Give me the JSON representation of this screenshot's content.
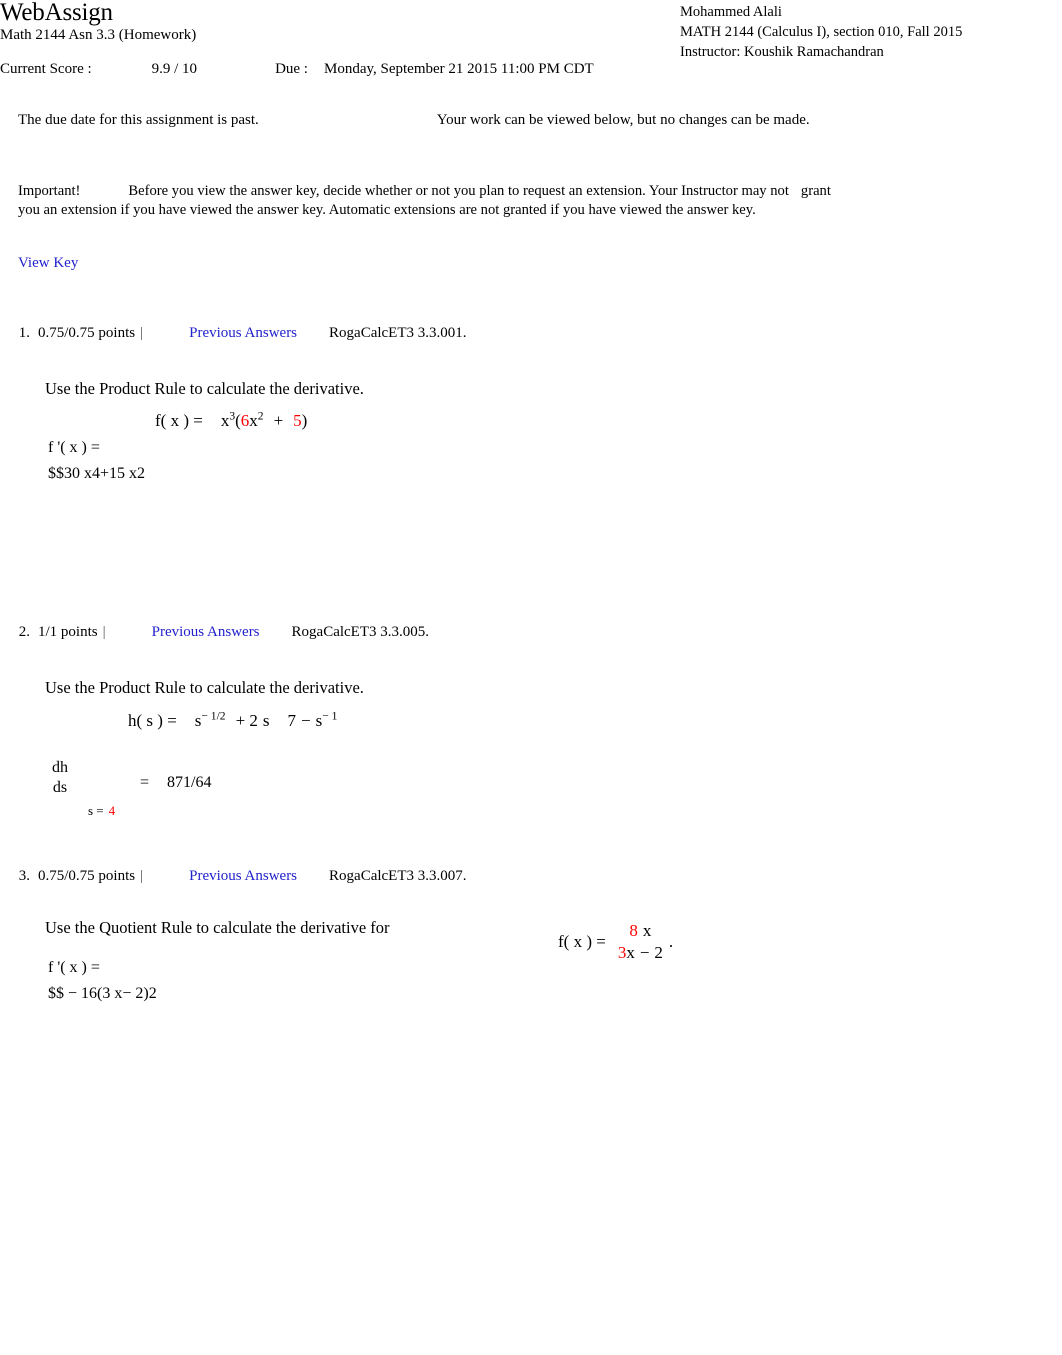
{
  "header": {
    "brand": "WebAssign",
    "assignment_title": "Math 2144 Asn 3.3 (Homework)",
    "student_name": "Mohammed Alali",
    "course_line": "MATH 2144 (Calculus I), section 010, Fall 2015",
    "instructor_line": "Instructor: Koushik Ramachandran",
    "score_label": "Current Score :",
    "score_value": "9.9 / 10",
    "due_label": "Due :",
    "due_value": "Monday, September 21 2015 11:00 PM CDT"
  },
  "notices": {
    "past_due_left": "The due date for this assignment is past.",
    "past_due_right": "Your work can be viewed below, but no changes can be made.",
    "important_word": "Important!",
    "important_text_a": "Before you view the answer key, decide whether or not you plan to request an extension. Your Instructor may",
    "important_text_b": "not",
    "important_text_c": "grant you an extension if you have viewed the answer key. Automatic extensions are not granted if you have viewed the",
    "important_text_d": "answer key.",
    "view_key_label": "View Key"
  },
  "colors": {
    "link_blue": "#2222CC",
    "highlight_red": "#FF0000",
    "text_black": "#000000"
  },
  "questions": [
    {
      "number": "1.",
      "points": "0.75/0.75 points",
      "separator": "|",
      "previous_answers_label": "Previous Answers",
      "problem_code": "RogaCalcET3 3.3.001.",
      "prompt": "Use the Product Rule to calculate the derivative.",
      "function_label": "f( x ) =",
      "function_base": "x",
      "function_base_exp": "3",
      "function_paren_open": "(",
      "function_coef": "6",
      "function_var": "x",
      "function_var_exp": "2",
      "function_plus": "+",
      "function_const": "5",
      "function_paren_close": ")",
      "answer_label": "f '( x ) =",
      "answer_value": "$$30  x4+15  x2"
    },
    {
      "number": "2.",
      "points": "1/1 points",
      "separator": "|",
      "previous_answers_label": "Previous Answers",
      "problem_code": "RogaCalcET3 3.3.005.",
      "prompt": "Use the Product Rule to calculate the derivative.",
      "function_label": "h( s ) =",
      "term1_base": "s",
      "term1_exp": "− 1/2",
      "term2_plus": "+ 2",
      "term2_var": "s",
      "term3_num": "7",
      "term3_minus": "−",
      "term4_base": "s",
      "term4_exp": "− 1",
      "deriv_numerator": "dh",
      "deriv_denominator": "ds",
      "eval_var": "s  =",
      "eval_value": "4",
      "equals": "=",
      "answer_value": "871/64"
    },
    {
      "number": "3.",
      "points": "0.75/0.75 points",
      "separator": "|",
      "previous_answers_label": "Previous Answers",
      "problem_code": "RogaCalcET3 3.3.007.",
      "prompt": "Use the Quotient Rule to calculate the derivative for",
      "function_label": "f( x ) =",
      "frac_numerator_coef": "8",
      "frac_numerator_var": "x",
      "frac_denominator_coef": "3",
      "frac_denominator_var": "x",
      "frac_denominator_minus": "−",
      "frac_denominator_const": "2",
      "period": ".",
      "answer_label": "f '( x ) =",
      "answer_value": "$$ − 16(3  x− 2)2"
    }
  ]
}
